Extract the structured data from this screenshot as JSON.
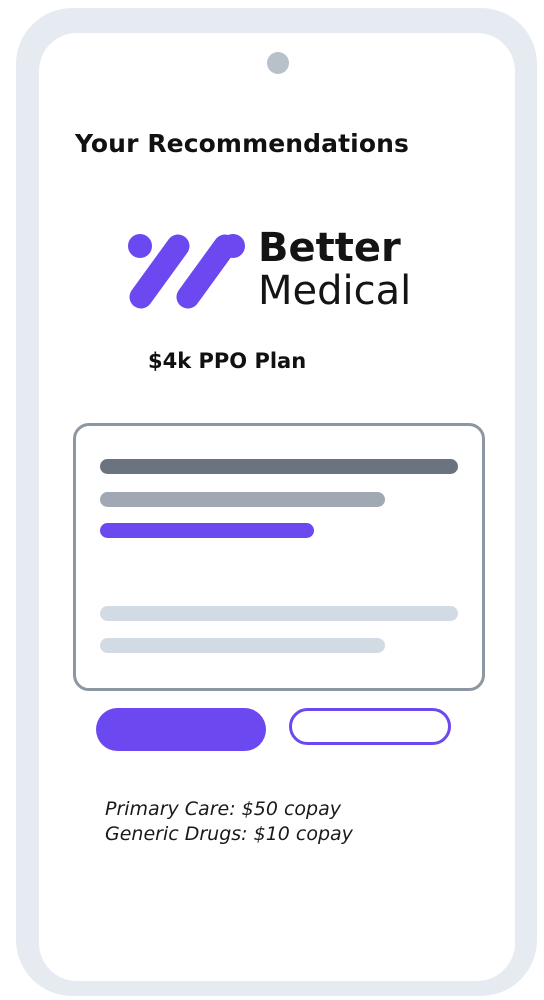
{
  "screen": {
    "heading": "Your Recommendations"
  },
  "brand": {
    "name_line_1": "Better",
    "name_line_2": "Medical",
    "logo_icon": "better-medical-logo-mark",
    "accent_color": "#6c48f0"
  },
  "plan": {
    "name": "$4k PPO Plan"
  },
  "details": {
    "primary_care": "Primary Care: $50 copay",
    "generic_drugs": "Generic Drugs: $10 copay"
  }
}
